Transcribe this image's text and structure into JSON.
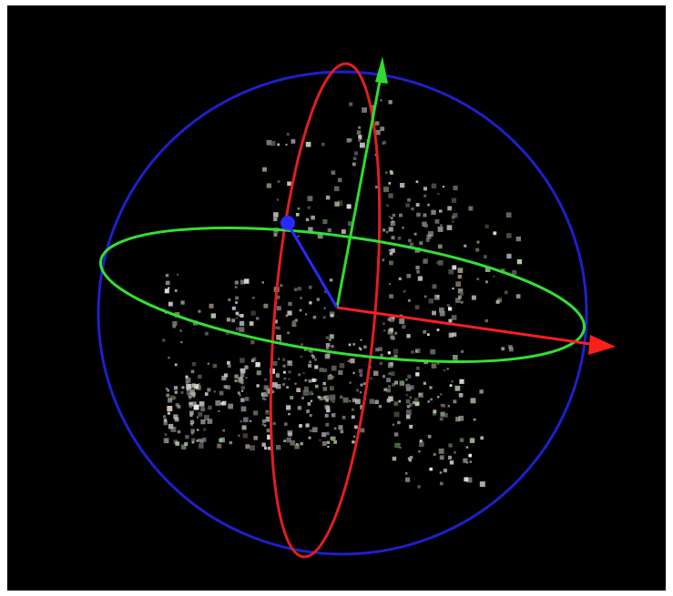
{
  "viewport": {
    "background": "#000000",
    "content": "point-cloud"
  },
  "gizmo": {
    "type": "rotation-sphere",
    "rings": [
      {
        "axis": "z",
        "color": "#1f1fcc"
      },
      {
        "axis": "x",
        "color": "#e01f1f"
      },
      {
        "axis": "y",
        "color": "#33e033"
      }
    ],
    "axes": [
      {
        "axis": "x",
        "color": "#ff1e1e",
        "head": "arrow"
      },
      {
        "axis": "y",
        "color": "#2edc2e",
        "head": "arrow"
      },
      {
        "axis": "z",
        "color": "#2a2aff",
        "head": "dot"
      }
    ]
  },
  "icons": {
    "x-arrow": "arrow-right-icon",
    "y-arrow": "arrow-up-icon",
    "z-handle": "dot-handle-icon"
  }
}
